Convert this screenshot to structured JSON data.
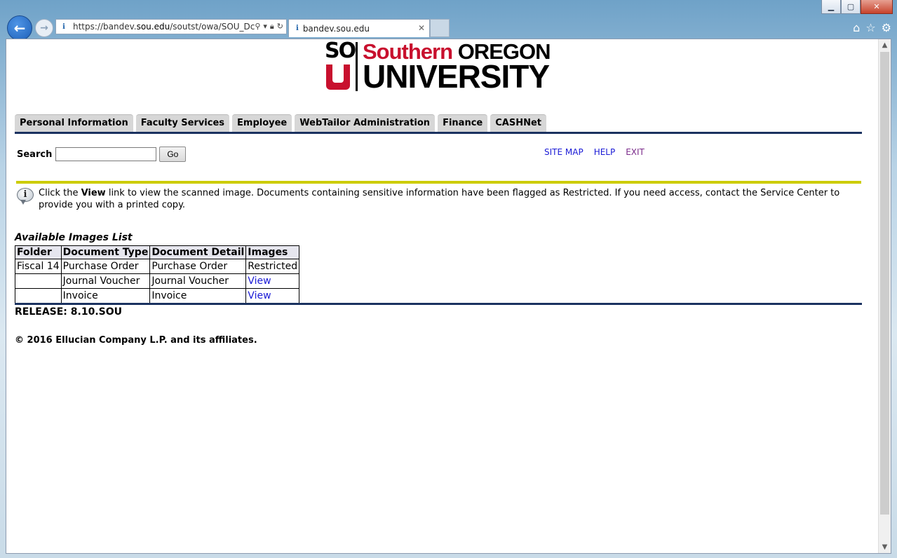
{
  "browser": {
    "url_prefix": "https://bandev.",
    "url_host": "sou.edu",
    "url_path": "/soutst/owa/SOU_Dc",
    "tab_title": "bandev.sou.edu"
  },
  "logo": {
    "so": "SO",
    "line1_red": "Southern",
    "line1_black": "OREGON",
    "line2": "UNIVERSITY"
  },
  "nav": {
    "tabs": [
      "Personal Information",
      "Faculty Services",
      "Employee",
      "WebTailor Administration",
      "Finance",
      "CASHNet"
    ]
  },
  "search": {
    "label": "Search",
    "value": "",
    "button": "Go"
  },
  "links": {
    "site_map": "SITE MAP",
    "help": "HELP",
    "exit": "EXIT"
  },
  "info": {
    "prefix": "Click the ",
    "bold": "View",
    "suffix": " link to view the scanned image. Documents containing sensitive information have been flagged as Restricted. If you need access, contact the Service Center to provide you with a printed copy."
  },
  "table": {
    "caption": "Available Images List",
    "headers": [
      "Folder",
      "Document Type",
      "Document Detail",
      "Images"
    ],
    "rows": [
      {
        "folder": "Fiscal 14",
        "type": "Purchase Order",
        "detail": "Purchase Order",
        "images": "Restricted"
      },
      {
        "folder": "",
        "type": "Journal Voucher",
        "detail": "Journal Voucher",
        "images": "View"
      },
      {
        "folder": "",
        "type": "Invoice",
        "detail": "Invoice",
        "images": "View"
      }
    ]
  },
  "footer": {
    "release": "RELEASE: 8.10.SOU",
    "copyright": "© 2016 Ellucian Company L.P. and its affiliates."
  }
}
